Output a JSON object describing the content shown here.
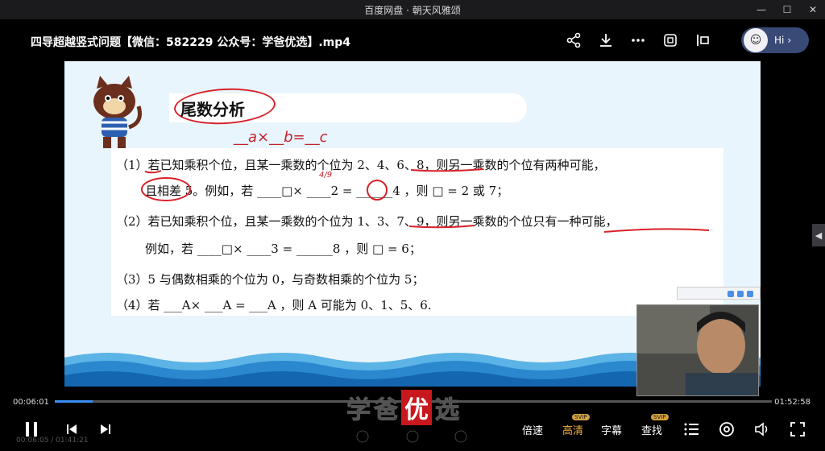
{
  "window": {
    "title": "百度网盘 · 朝天风雅颂",
    "controls": [
      "minimize",
      "maximize",
      "close"
    ]
  },
  "header": {
    "file_title": "四导超越竖式问题【微信：582229 公众号：学爸优选】.mp4",
    "icons": [
      "share-icon",
      "download-icon",
      "more-icon",
      "screenshot-icon",
      "pip-icon"
    ],
    "assistant_label": "Hi"
  },
  "slide": {
    "section_title": "尾数分析",
    "handwritten": "__a×__b=__c",
    "lines": [
      "（1）若已知乘积个位，且某一乘数的个位为 2、4、6、8，则另一乘数的个位有两种可能，",
      "且相差 5。例如，若 ____□× ____2 = ______4 ，则 □ = 2 或 7；",
      "（2）若已知乘积个位，且某一乘数的个位为 1、3、7、9，则另一乘数的个位只有一种可能，",
      "例如，若 ____□× ____3 = ______8 ，则 □ = 6；",
      "（3）5 与偶数相乘的个位为 0，与奇数相乘的个位为 5；",
      "（4）若 ___A× ___A = ___A ，则 A 可能为 0、1、5、6."
    ],
    "annotation_49": "4/9"
  },
  "player": {
    "time_current": "00:06:01",
    "time_total": "01:52:58",
    "progress_fraction": 0.053,
    "ghost_text": "00:06:05 / 01:41:21",
    "watermark_chars": [
      "学",
      "爸",
      "优",
      "选"
    ],
    "speed_label": "倍速",
    "quality_label": "高清",
    "quality_badge": "SVIP",
    "subtitle_label": "字幕",
    "find_label": "查找",
    "find_badge": "SVIP"
  },
  "colors": {
    "accent_blue": "#3a8ef6",
    "hd_gold": "#f0b040",
    "mark_red": "#d7212a"
  }
}
